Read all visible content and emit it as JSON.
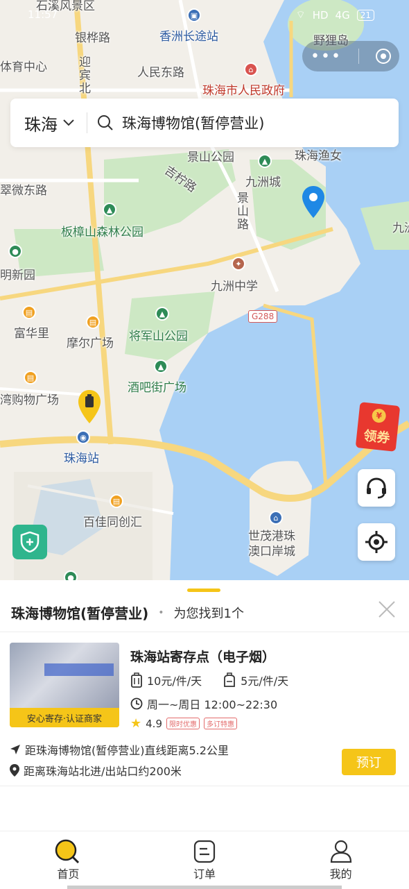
{
  "status_bar": {
    "time": "11:57",
    "network": "HD",
    "cellular": "4G",
    "battery": "21"
  },
  "map": {
    "labels": {
      "shixi": "石溪风景区",
      "xiangzhou_bus": "香洲长途站",
      "yeli_island": "野狸岛",
      "sports_center": "体育中心",
      "yinhua_road": "银桦路",
      "yingbin_north": "迎宾北",
      "renmin_east": "人民东路",
      "gov": "珠海市人民政府",
      "jingshan_park": "景山公园",
      "zhuhai_fisher": "珠海渔女",
      "jizhuo_road": "吉柠路",
      "cuiwei_east": "翠微东路",
      "jiuzhou_city": "九洲城",
      "jingshan_road": "景山路",
      "jiu": "九洲",
      "banzhang_park": "板樟山森林公园",
      "ming_garden": "明新园",
      "jiuzhou_school": "九洲中学",
      "g288": "G288",
      "fuhua_li": "富华里",
      "moer_plaza": "摩尔广场",
      "jiangjun_park": "将军山公园",
      "jiuba_plaza": "酒吧街广场",
      "wan_mall": "湾购物广场",
      "zhuhai_station": "珠海站",
      "baijia": "百佳同创汇",
      "port": "世茂港珠澳口岸城"
    },
    "coupon_label": "领券"
  },
  "search": {
    "city": "珠海",
    "query": "珠海博物馆(暂停营业)"
  },
  "result": {
    "title": "珠海博物馆(暂停营业)",
    "separator": "•",
    "count_text": "为您找到1个",
    "card": {
      "name": "珠海站寄存点（电子烟）",
      "badge": "安心寄存·认证商家",
      "price_large": "10元/件/天",
      "price_small": "5元/件/天",
      "hours": "周一~周日 12:00~22:30",
      "rating": "4.9",
      "tags": [
        "限时优惠",
        "多订特惠"
      ],
      "distance": "距珠海博物馆(暂停营业)直线距离5.2公里",
      "exit": "距离珠海站北进/出站口约200米",
      "book_label": "预订"
    }
  },
  "tabbar": {
    "home": "首页",
    "orders": "订单",
    "mine": "我的"
  },
  "colors": {
    "accent": "#f5c518",
    "water": "#a9d0f5",
    "park": "#cde8c4",
    "road": "#f7d77f",
    "coupon": "#e8382f",
    "shield": "#2fb58d"
  }
}
